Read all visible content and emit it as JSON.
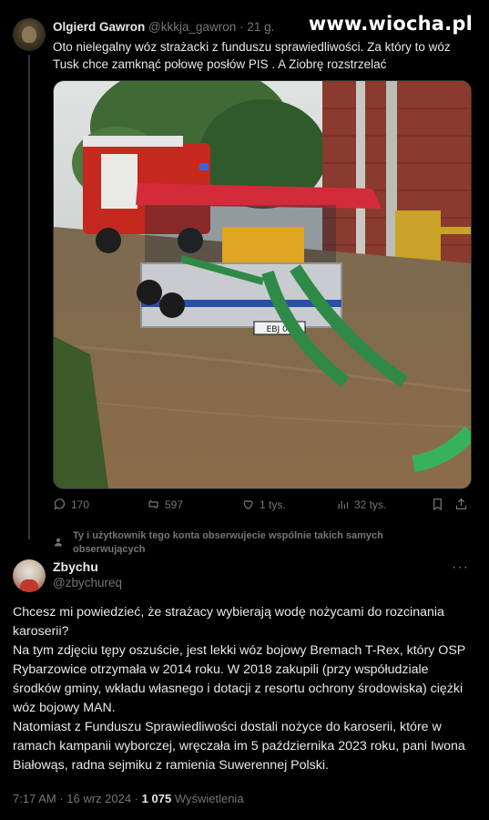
{
  "watermark": "www.wiocha.pl",
  "tweet1": {
    "author_name": "Olgierd Gawron",
    "author_handle": "@kkkja_gawron",
    "separator": "·",
    "time": "21 g.",
    "text": "Oto nielegalny wóz strażacki z funduszu sprawiedliwości. Za który to wóz Tusk chce zamknąć połowę posłów PIS . A Ziobrę rozstrzelać",
    "actions": {
      "replies": "170",
      "reposts": "597",
      "likes": "1 tys.",
      "views": "32 tys."
    },
    "photo_plate": "EBJ 04",
    "follow_note": "Ty i użytkownik tego konta obserwujecie wspólnie takich samych obserwujących"
  },
  "tweet2": {
    "author_name": "Zbychu",
    "author_handle": "@zbychureq",
    "more": "···",
    "paragraphs": [
      "Chcesz mi powiedzieć, że strażacy wybierają wodę nożycami do rozcinania karoserii?",
      "Na tym zdjęciu tępy oszuście, jest lekki wóz bojowy Bremach T-Rex, który OSP Rybarzowice otrzymała w 2014 roku. W 2018 zakupili (przy współudziale środków gminy, wkładu własnego i dotacji z resortu ochrony środowiska) ciężki wóz bojowy MAN.",
      "Natomiast z Funduszu Sprawiedliwości dostali nożyce do karoserii, które w ramach kampanii wyborczej, wręczała im 5 października 2023 roku, pani Iwona  Białowąs, radna sejmiku z ramienia Suwerennej Polski."
    ],
    "time": "7:17 AM · 16 wrz 2024 ·",
    "views_count": "1 075",
    "views_label": "Wyświetlenia"
  },
  "colors": {
    "background": "#000000",
    "text": "#e7e9ea",
    "muted": "#71767b"
  },
  "icons": [
    "reply-icon",
    "repost-icon",
    "like-icon",
    "views-icon",
    "bookmark-icon",
    "share-icon",
    "follow-icon"
  ]
}
